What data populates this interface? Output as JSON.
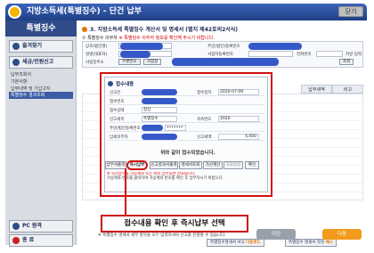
{
  "window": {
    "title": "지방소득세(특별징수) - 단건 납부",
    "close_label": "닫기"
  },
  "sidebar": {
    "header": "특별징수",
    "buttons": [
      {
        "label": "즐겨찾기"
      },
      {
        "label": "세금/민원신고"
      }
    ],
    "sub_items": [
      {
        "label": "납부조회서"
      },
      {
        "label": "기본사항"
      },
      {
        "label": "납부내역 및 기납고지"
      },
      {
        "label": "특별징수 결과조회",
        "active": true
      }
    ],
    "bottom_buttons": [
      {
        "label": "PC 원격"
      },
      {
        "label": "종 료"
      }
    ]
  },
  "main": {
    "title": "3. 지방소득세 특별징수 계산서 및 명세서 (별지 제42호의2서식)",
    "section_note": "① 특별징수 의무자",
    "section_note_warn": "※ 특별징수 의무자 정보를 확인해 주시기 바랍니다.",
    "form_labels": [
      "상호(법인명)",
      "성명(대표자)",
      "사업장주소",
      "주민(법인)등록번호",
      "사업자등록번호",
      "전화번호"
    ],
    "form_buttons": [
      "우편번호",
      "사업장"
    ],
    "right_buttons": [
      "조회"
    ],
    "side_badge": "지방 입력",
    "column_headers": [
      "납부세액",
      "비고"
    ],
    "bottom_note": "※ 특별징수 명세서 세부 항목을 모두 입력하셔야 신고를 진행할 수 있습니다.",
    "link_buttons": [
      {
        "label": "특별징수명세서 서식",
        "suffix": "다운로드"
      },
      {
        "label": "특별징수 명세서 작성",
        "suffix": "예시"
      }
    ],
    "prev_label": "이전",
    "next_label": "다음"
  },
  "dialog": {
    "header": "접수내용",
    "rows": [
      {
        "label": "신고인",
        "value": "",
        "label2": "접수일자",
        "value2": "2020-07-09"
      },
      {
        "label": "접수번호",
        "value": "",
        "label2": "",
        "value2": ""
      },
      {
        "label": "접수상태",
        "value": "정상",
        "label2": "",
        "value2": ""
      },
      {
        "label": "신고세목",
        "value": "특별징수",
        "label2": "귀속연도",
        "value2": "2020"
      },
      {
        "label": "주민/법인등록번호",
        "value": "",
        "label2": "",
        "value2": ""
      },
      {
        "label": "납세의무자",
        "value": "",
        "label2": "신고세액",
        "value2": "4,000"
      }
    ],
    "message": "위와 같이 접수되었습니다.",
    "buttons": [
      {
        "label": "납부서출력"
      },
      {
        "label": "즉시납부",
        "highlight": true
      },
      {
        "label": "신고결과서출력"
      },
      {
        "label": "명세서조회"
      },
      {
        "label": "가산계산"
      },
      {
        "label": "자료정정"
      },
      {
        "label": "확인"
      }
    ],
    "warnings": [
      "※ 즉시납부를 가상계좌 또는 바로 납부되면 완료됩니다.",
      "가상계좌 번호를 클릭하여 가상계좌 번호를 확인 후 납부하시기 바랍니다."
    ]
  },
  "callout": {
    "text": "접수내용 확인 후 즉시납부 선택"
  },
  "colors": {
    "title_bar": "#2f4b8a",
    "highlight_red": "#d01010",
    "redaction_blue": "#3558c9",
    "next_orange": "#f19a1c"
  }
}
